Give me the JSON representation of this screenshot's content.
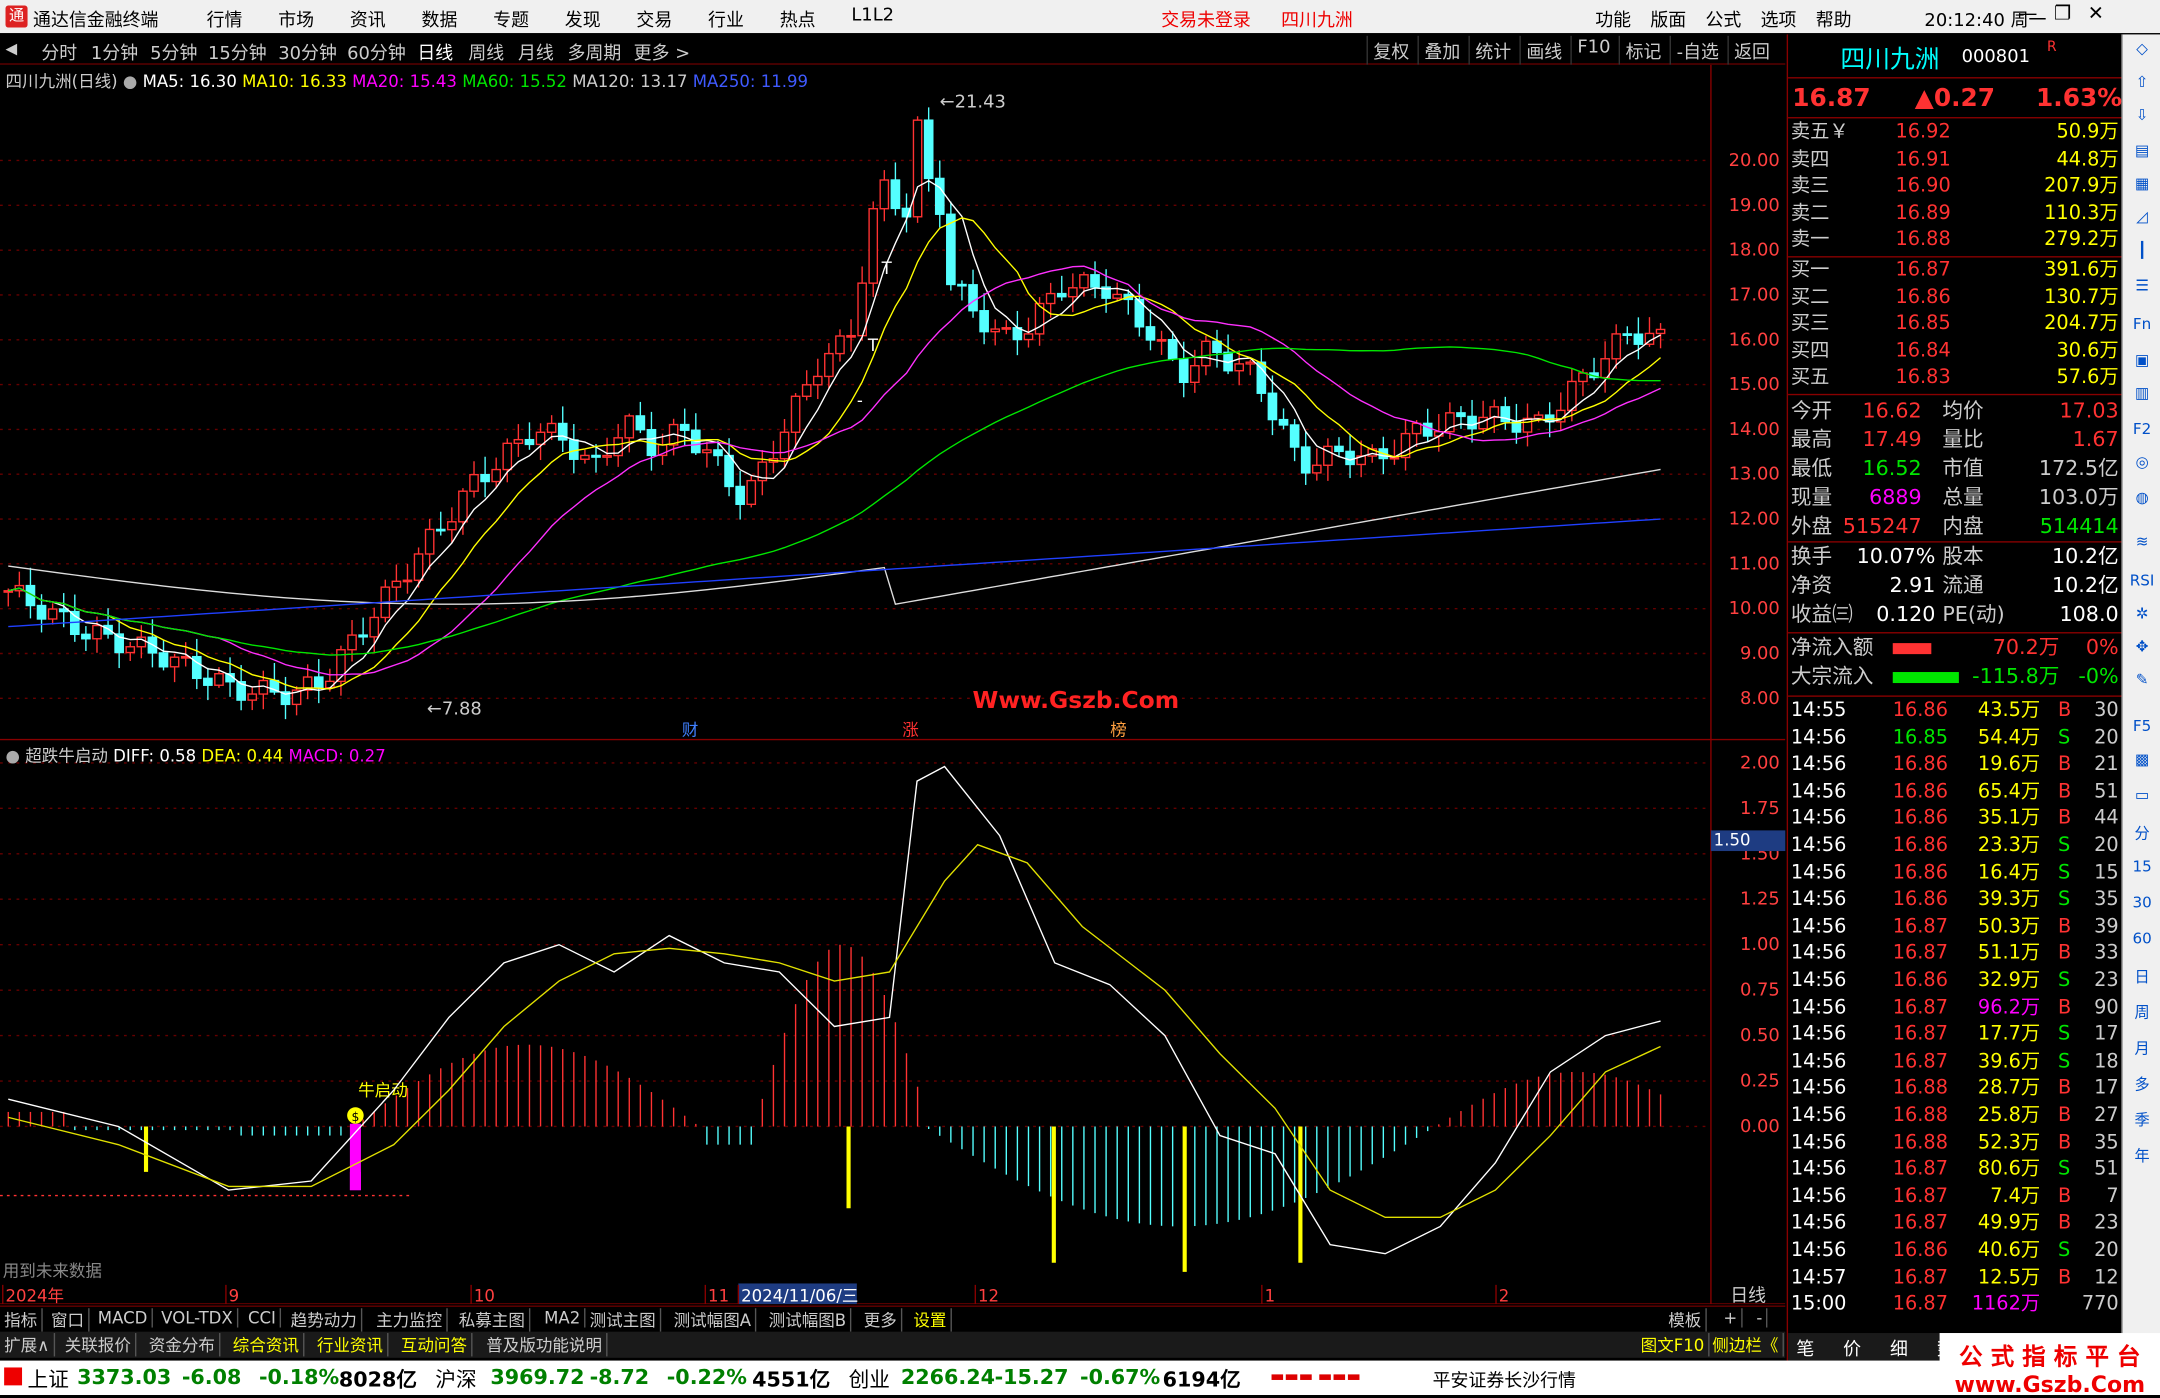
{
  "titlebar": {
    "app_title": "通达信金融终端",
    "menu": [
      "行情",
      "市场",
      "资讯",
      "数据",
      "专题",
      "发现",
      "交易",
      "行业",
      "热点",
      "L1L2"
    ],
    "login": "交易未登录",
    "stock": "四川九洲",
    "right_menu": [
      "功能",
      "版面",
      "公式",
      "选项",
      "帮助"
    ],
    "time": "20:12:40",
    "weekday": "周一"
  },
  "periods": [
    "分时",
    "1分钟",
    "5分钟",
    "15分钟",
    "30分钟",
    "60分钟",
    "日线",
    "周线",
    "月线",
    "多周期",
    "更多 >"
  ],
  "selected_period": "日线",
  "tools": [
    "复权",
    "叠加",
    "统计",
    "画线",
    "F10",
    "标记",
    "-自选",
    "返回"
  ],
  "ma": {
    "title": "四川九洲(日线)",
    "ma5": "MA5: 16.30",
    "ma10": "MA10: 16.33",
    "ma20": "MA20: 15.43",
    "ma60": "MA60: 15.52",
    "ma120": "MA120: 13.17",
    "ma250": "MA250: 11.99"
  },
  "macd": {
    "name": "超跌牛启动",
    "diff": "DIFF: 0.58",
    "dea": "DEA: 0.44",
    "macd": "MACD: 0.27",
    "signal_label": "牛启动",
    "badge": "$",
    "future_note": "用到未来数据",
    "hover_value": "1.50"
  },
  "price_axis": [
    "20.00",
    "19.00",
    "18.00",
    "17.00",
    "16.00",
    "15.00",
    "14.00",
    "13.00",
    "12.00",
    "11.00",
    "10.00",
    "9.00",
    "8.00"
  ],
  "macd_axis": [
    "2.00",
    "1.75",
    "1.50",
    "1.25",
    "1.00",
    "0.75",
    "0.50",
    "0.25",
    "0.00"
  ],
  "annotations": {
    "high": "21.43",
    "low": "7.88",
    "events": [
      "财",
      "涨",
      "榜"
    ],
    "t_marks": [
      "T",
      "T",
      "-"
    ]
  },
  "date_axis": {
    "labels": [
      "2024年",
      "9",
      "10",
      "11",
      "2024/11/06/三",
      "12",
      "1",
      "2"
    ],
    "period_label": "日线"
  },
  "watermark": "Www.Gszb.Com",
  "tabs1": [
    "指标",
    "窗口",
    "MACD",
    "VOL-TDX",
    "CCI",
    "趋势动力",
    "主力监控",
    "私募主图",
    "MA2",
    "测试主图",
    "测试幅图A",
    "测试幅图B",
    "更多",
    "设置"
  ],
  "tabs1_right": [
    "模板",
    "+",
    "-"
  ],
  "tabs2": [
    "扩展∧",
    "关联报价",
    "资金分布",
    "综合资讯",
    "行业资讯",
    "互动问答",
    "普及版功能说明"
  ],
  "tabs2_right": [
    "图文F10",
    "侧边栏《"
  ],
  "panel": {
    "name": "四川九洲",
    "code": "000801",
    "flag": "R",
    "price": "16.87",
    "change": "▲0.27",
    "pct": "1.63%",
    "asks": [
      [
        "卖五￥",
        "16.92",
        "50.9万"
      ],
      [
        "卖四",
        "16.91",
        "44.8万"
      ],
      [
        "卖三",
        "16.90",
        "207.9万"
      ],
      [
        "卖二",
        "16.89",
        "110.3万"
      ],
      [
        "卖一",
        "16.88",
        "279.2万"
      ]
    ],
    "bids": [
      [
        "买一",
        "16.87",
        "391.6万"
      ],
      [
        "买二",
        "16.86",
        "130.7万"
      ],
      [
        "买三",
        "16.85",
        "204.7万"
      ],
      [
        "买四",
        "16.84",
        "30.6万"
      ],
      [
        "买五",
        "16.83",
        "57.6万"
      ]
    ],
    "stats": [
      [
        "今开",
        "16.62",
        "均价",
        "17.03"
      ],
      [
        "最高",
        "17.49",
        "量比",
        "1.67"
      ],
      [
        "最低",
        "16.52",
        "市值",
        "172.5亿"
      ],
      [
        "现量",
        "6889",
        "总量",
        "103.0万"
      ],
      [
        "外盘",
        "515247",
        "内盘",
        "514414"
      ]
    ],
    "stats2": [
      [
        "换手",
        "10.07%",
        "股本",
        "10.2亿"
      ],
      [
        "净资",
        "2.91",
        "流通",
        "10.2亿"
      ],
      [
        "收益㈢",
        "0.120",
        "PE(动)",
        "108.0"
      ]
    ],
    "flows": [
      [
        "净流入额",
        "70.2万",
        "0%"
      ],
      [
        "大宗流入",
        "-115.8万",
        "-0%"
      ]
    ],
    "ticks": [
      [
        "14:55",
        "16.86",
        "43.5万",
        "B",
        "30"
      ],
      [
        "14:56",
        "16.85",
        "54.4万",
        "S",
        "20"
      ],
      [
        "14:56",
        "16.86",
        "19.6万",
        "B",
        "21"
      ],
      [
        "14:56",
        "16.86",
        "65.4万",
        "B",
        "51"
      ],
      [
        "14:56",
        "16.86",
        "35.1万",
        "B",
        "44"
      ],
      [
        "14:56",
        "16.86",
        "23.3万",
        "S",
        "20"
      ],
      [
        "14:56",
        "16.86",
        "16.4万",
        "S",
        "15"
      ],
      [
        "14:56",
        "16.86",
        "39.3万",
        "S",
        "35"
      ],
      [
        "14:56",
        "16.87",
        "50.3万",
        "B",
        "39"
      ],
      [
        "14:56",
        "16.87",
        "51.1万",
        "B",
        "33"
      ],
      [
        "14:56",
        "16.86",
        "32.9万",
        "S",
        "23"
      ],
      [
        "14:56",
        "16.87",
        "96.2万",
        "B",
        "90"
      ],
      [
        "14:56",
        "16.87",
        "17.7万",
        "S",
        "17"
      ],
      [
        "14:56",
        "16.87",
        "39.6万",
        "S",
        "18"
      ],
      [
        "14:56",
        "16.88",
        "28.7万",
        "B",
        "17"
      ],
      [
        "14:56",
        "16.88",
        "25.8万",
        "B",
        "27"
      ],
      [
        "14:56",
        "16.88",
        "52.3万",
        "B",
        "35"
      ],
      [
        "14:56",
        "16.87",
        "80.6万",
        "S",
        "51"
      ],
      [
        "14:56",
        "16.87",
        "7.4万",
        "B",
        "7"
      ],
      [
        "14:56",
        "16.87",
        "49.9万",
        "B",
        "23"
      ],
      [
        "14:56",
        "16.86",
        "40.6万",
        "S",
        "20"
      ],
      [
        "14:57",
        "16.87",
        "12.5万",
        "B",
        "12"
      ],
      [
        "15:00",
        "16.87",
        "1162万",
        "",
        "770"
      ]
    ],
    "bottom_tabs": [
      "笔",
      "价",
      "细",
      "势"
    ]
  },
  "sideicons": [
    "分",
    "F5",
    "15",
    "30",
    "60",
    "日",
    "周",
    "月",
    "年",
    "多",
    "季"
  ],
  "statusbar": {
    "items": [
      [
        "上证",
        "3373.03",
        "-6.08",
        "-0.18%",
        "8028亿"
      ],
      [
        "沪深",
        "3969.72",
        "-8.72",
        "-0.22%",
        "4551亿"
      ],
      [
        "创业",
        "2266.24",
        "-15.27",
        "-0.67%",
        "6194亿"
      ]
    ],
    "broker": "平安证券长沙行情"
  },
  "wm_bottom": {
    "line1": "公 式 指 标 平 台",
    "line2": "www.Gszb.Com"
  }
}
